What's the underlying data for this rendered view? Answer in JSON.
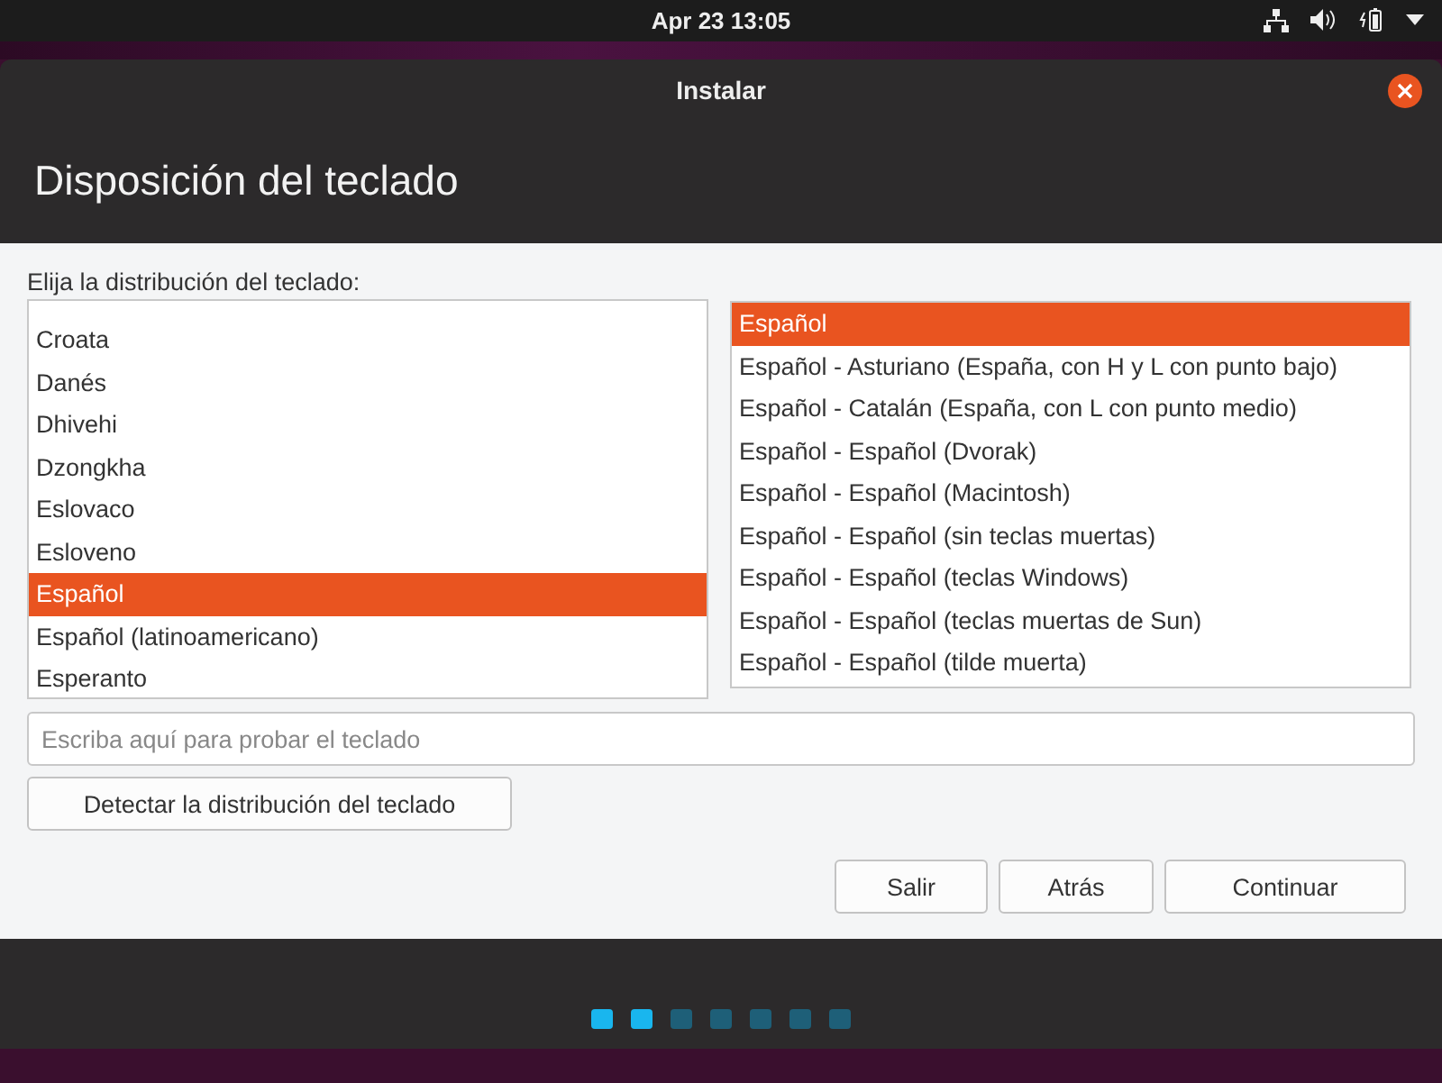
{
  "top_bar": {
    "clock": "Apr 23  13:05"
  },
  "window": {
    "title": "Instalar"
  },
  "heading": "Disposición del teclado",
  "prompt": "Elija la distribución del teclado:",
  "layouts": [
    {
      "label": "Croata",
      "selected": false
    },
    {
      "label": "Danés",
      "selected": false
    },
    {
      "label": "Dhivehi",
      "selected": false
    },
    {
      "label": "Dzongkha",
      "selected": false
    },
    {
      "label": "Eslovaco",
      "selected": false
    },
    {
      "label": "Esloveno",
      "selected": false
    },
    {
      "label": "Español",
      "selected": true
    },
    {
      "label": "Español (latinoamericano)",
      "selected": false
    },
    {
      "label": "Esperanto",
      "selected": false
    }
  ],
  "variants": [
    {
      "label": "Español",
      "selected": true
    },
    {
      "label": "Español - Asturiano (España, con H y L con punto bajo)",
      "selected": false
    },
    {
      "label": "Español - Catalán (España, con L con punto medio)",
      "selected": false
    },
    {
      "label": "Español - Español (Dvorak)",
      "selected": false
    },
    {
      "label": "Español - Español (Macintosh)",
      "selected": false
    },
    {
      "label": "Español - Español (sin teclas muertas)",
      "selected": false
    },
    {
      "label": "Español - Español (teclas Windows)",
      "selected": false
    },
    {
      "label": "Español - Español (teclas muertas de Sun)",
      "selected": false
    },
    {
      "label": "Español - Español (tilde muerta)",
      "selected": false
    }
  ],
  "test_field": {
    "placeholder": "Escriba aquí para probar el teclado"
  },
  "detect_button": "Detectar la distribución del teclado",
  "buttons": [
    "Salir",
    "Atrás",
    "Continuar"
  ],
  "steps": [
    {
      "done": true
    },
    {
      "done": true
    },
    {
      "done": false
    },
    {
      "done": false
    },
    {
      "done": false
    },
    {
      "done": false
    },
    {
      "done": false
    }
  ]
}
